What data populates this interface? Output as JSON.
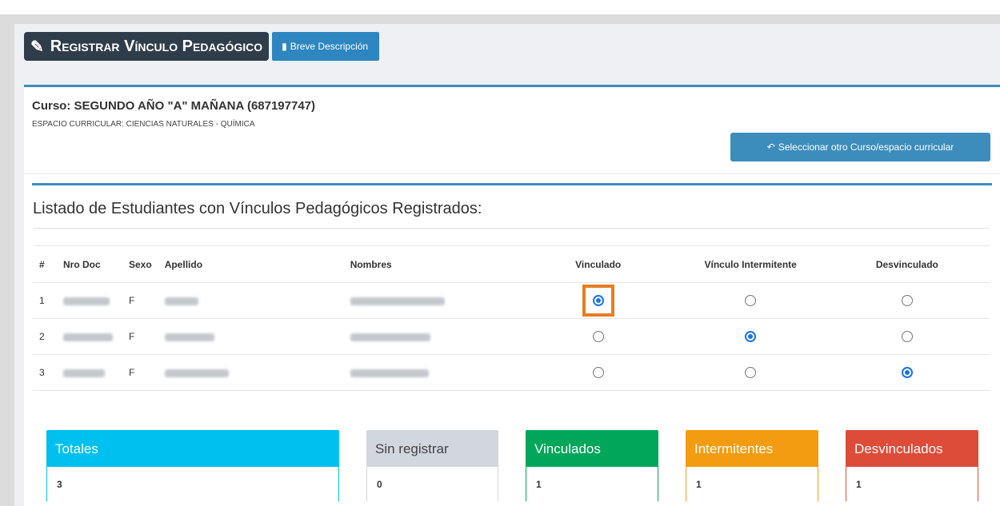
{
  "header": {
    "title": "Registrar Vínculo Pedagógico",
    "desc_button": "Breve Descripción"
  },
  "course": {
    "title": "Curso: SEGUNDO AÑO \"A\" MAÑANA (687197747)",
    "espacio": "ESPACIO CURRICULAR: CIENCIAS NATURALES - QUÍMICA",
    "select_button": "Seleccionar otro Curso/espacio curricular"
  },
  "list_title": "Listado de Estudiantes con Vínculos Pedagógicos Registrados:",
  "table": {
    "headers": {
      "num": "#",
      "doc": "Nro Doc",
      "sexo": "Sexo",
      "apellido": "Apellido",
      "nombres": "Nombres",
      "vinculado": "Vinculado",
      "intermitente": "Vínculo Intermitente",
      "desvinculado": "Desvinculado"
    },
    "rows": [
      {
        "num": "1",
        "sexo": "F",
        "status": "vinculado"
      },
      {
        "num": "2",
        "sexo": "F",
        "status": "intermitente"
      },
      {
        "num": "3",
        "sexo": "F",
        "status": "desvinculado"
      }
    ]
  },
  "summary": {
    "totales": {
      "label": "Totales",
      "value": "3",
      "color": "#00c0ef"
    },
    "sin_registrar": {
      "label": "Sin registrar",
      "value": "0",
      "color": "#d2d6de"
    },
    "vinculados": {
      "label": "Vinculados",
      "value": "1",
      "color": "#00a65a"
    },
    "intermitentes": {
      "label": "Intermitentes",
      "value": "1",
      "color": "#f39c12"
    },
    "desvinculados": {
      "label": "Desvinculados",
      "value": "1",
      "color": "#dd4b39"
    }
  }
}
